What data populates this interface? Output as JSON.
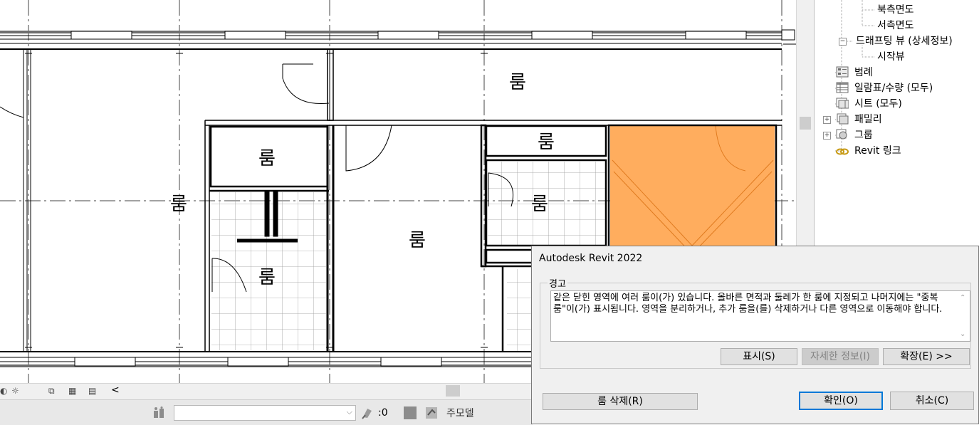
{
  "canvas": {
    "room_tag": "룸",
    "selected_fill": "#ffad5e",
    "wall_color": "#000000"
  },
  "project_browser": {
    "items": [
      {
        "label": "북측면도",
        "icon": "none",
        "expand": "none"
      },
      {
        "label": "서측면도",
        "icon": "none",
        "expand": "none"
      },
      {
        "label": "드래프팅 뷰 (상세정보)",
        "icon": "none",
        "expand": "minus"
      },
      {
        "label": "시작뷰",
        "icon": "none",
        "expand": "none"
      },
      {
        "label": "범례",
        "icon": "legend-icon",
        "expand": "none"
      },
      {
        "label": "일람표/수량 (모두)",
        "icon": "schedule-icon",
        "expand": "none"
      },
      {
        "label": "시트 (모두)",
        "icon": "sheet-icon",
        "expand": "none"
      },
      {
        "label": "패밀리",
        "icon": "family-icon",
        "expand": "plus"
      },
      {
        "label": "그룹",
        "icon": "group-icon",
        "expand": "plus"
      },
      {
        "label": "Revit 링크",
        "icon": "link-icon",
        "expand": "none"
      }
    ]
  },
  "view_control_bar": {
    "collapse_glyph": "<"
  },
  "status_bar": {
    "selection_count": ":0",
    "main_model": "주모델",
    "workset_value": ""
  },
  "dialog": {
    "title": "Autodesk Revit 2022",
    "group_label": "경고",
    "message": "같은 닫힌 영역에 여러 룸이(가) 있습니다. 올바른 면적과 둘레가 한 룸에 지정되고 나머지에는 \"중복 룸\"이(가) 표시됩니다. 영역을 분리하거나, 추가 룸을(를) 삭제하거나 다른 영역으로 이동해야 합니다.",
    "buttons": {
      "show": "표시(S)",
      "more_info": "자세한 정보(I)",
      "expand": "확장(E) >>",
      "delete_room": "룸 삭제(R)",
      "ok": "확인(O)",
      "cancel": "취소(C)"
    }
  }
}
